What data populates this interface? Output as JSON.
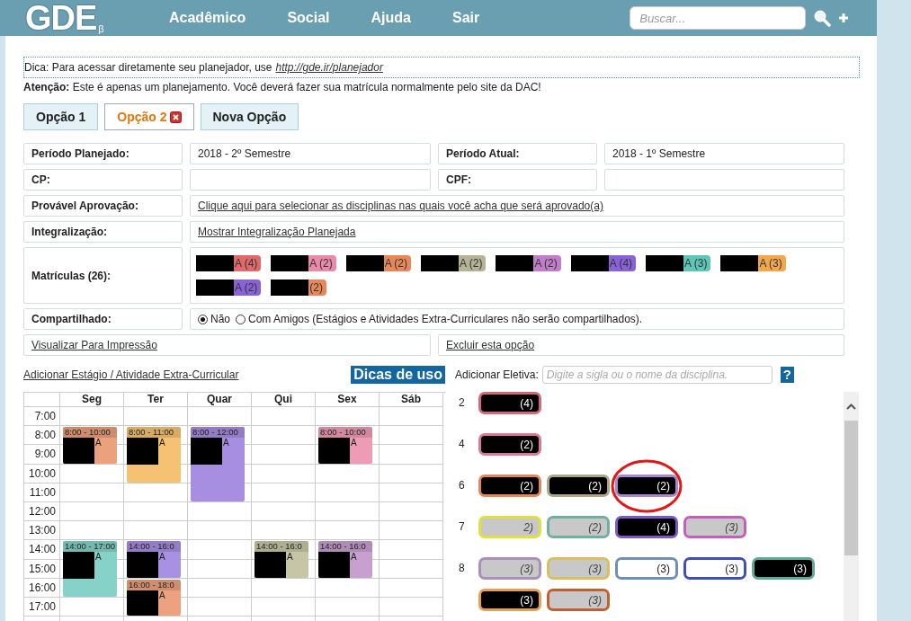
{
  "header": {
    "logo": "GDE",
    "logo_mark": "β",
    "nav": [
      "Acadêmico",
      "Social",
      "Ajuda",
      "Sair"
    ],
    "search": {
      "placeholder": "Buscar..."
    }
  },
  "tip": {
    "text": "Dica: Para acessar diretamente seu planejador, use",
    "link": "http://gde.ir/planejador"
  },
  "notice": "**Atenção:** Este é apenas um planejamento. Você deverá fazer sua matrícula normalmente pelo site da DAC!",
  "tabs": [
    {
      "label": "Opção 1",
      "selected": false,
      "closable": false
    },
    {
      "label": "Opção 2",
      "selected": true,
      "closable": true
    },
    {
      "label": "Nova Opção",
      "selected": false,
      "closable": false
    }
  ],
  "form": {
    "planned_period": {
      "label": "Período Planejado:",
      "value": "2018 - 2º Semestre"
    },
    "current_period": {
      "label": "Período Atual:",
      "value": "2018 - 1º Semestre"
    },
    "cp": {
      "label": "CP:"
    },
    "cpf": {
      "label": "CPF:"
    },
    "approval": {
      "label": "Provável Aprovação:",
      "link": "Clique aqui para selecionar as disciplinas nas quais você acha que será aprovado(a)"
    },
    "integration": {
      "label": "Integralização:",
      "link": "Mostrar Integralização Planejada"
    },
    "enrollments": {
      "label": "Matrículas (26):",
      "chips": [
        {
          "color": "#e06a6a",
          "text": "A (4)"
        },
        {
          "color": "#ea8aaa",
          "text": "A (2)"
        },
        {
          "color": "#e8885a",
          "text": "A (2)"
        },
        {
          "color": "#b4b494",
          "text": "A (2)"
        },
        {
          "color": "#c07ec8",
          "text": "A (2)"
        },
        {
          "color": "#8a62d8",
          "text": "A (4)"
        },
        {
          "color": "#5ec6b6",
          "text": "A (3)"
        },
        {
          "color": "#f2a84a",
          "text": "A (3)"
        },
        {
          "color": "#8a62d8",
          "text": "A (2)"
        },
        {
          "color": "#e8885a",
          "text": "(2)"
        }
      ]
    },
    "shared": {
      "label": "Compartilhado:",
      "options": [
        {
          "label": "Não",
          "selected": true
        },
        {
          "label": "Com Amigos (Estágios e Atividades Extra-Curriculares não serão compartilhados).",
          "selected": false
        }
      ]
    },
    "print_link": "Visualizar Para Impressão",
    "delete_link": "Excluir esta opção"
  },
  "schedule": {
    "add_link": "Adicionar Estágio / Atividade Extra-Curricular",
    "tips_button": "Dicas de uso",
    "hours": [
      "7:00",
      "8:00",
      "9:00",
      "10:00",
      "11:00",
      "12:00",
      "13:00",
      "14:00",
      "15:00",
      "16:00",
      "17:00"
    ],
    "days": [
      {
        "label": "Seg",
        "events": [
          {
            "start": "8:00",
            "dash": "-",
            "end": "10:00",
            "text": "A",
            "color": "#eba07e"
          },
          {
            "start": "14:00",
            "dash": "-",
            "end": "17:00",
            "text": "A",
            "color": "#86d2c8"
          }
        ]
      },
      {
        "label": "Ter",
        "events": [
          {
            "start": "8:00",
            "dash": "-",
            "end": "11:00",
            "text": "A",
            "color": "#f5c274"
          },
          {
            "start": "14:00",
            "dash": "-",
            "end": "16:0",
            "text": "A",
            "color": "#a890e2"
          },
          {
            "start": "16:00",
            "dash": "-",
            "end": "18:0",
            "text": "A",
            "color": "#eca27e"
          }
        ]
      },
      {
        "label": "Quar",
        "events": [
          {
            "start": "8:00",
            "dash": "-",
            "end": "12:00",
            "text": "A",
            "color": "#a88ee0"
          }
        ]
      },
      {
        "label": "Qui",
        "events": [
          {
            "start": "14:00",
            "dash": "-",
            "end": "16:0",
            "text": "A",
            "color": "#c6c6a6"
          }
        ]
      },
      {
        "label": "Sex",
        "events": [
          {
            "start": "8:00",
            "dash": "-",
            "end": "10:00",
            "text": "A",
            "color": "#ee9cb6"
          },
          {
            "start": "14:00",
            "dash": "-",
            "end": "16:0",
            "text": "A",
            "color": "#c8a0d0"
          }
        ]
      },
      {
        "label": "Sáb"
      }
    ]
  },
  "electives": {
    "label": "Adicionar Eletiva:",
    "placeholder": "Digite a sigla ou o nome da disciplina.",
    "help": "?",
    "rows": [
      {
        "semester": "2",
        "chips": [
          {
            "kind": "redacted",
            "color": "#d06a78",
            "text": "(4)",
            "circled": false
          }
        ]
      },
      {
        "semester": "4",
        "chips": [
          {
            "kind": "redacted",
            "color": "#d8789a",
            "text": "(2)",
            "circled": false
          }
        ]
      },
      {
        "semester": "6",
        "chips": [
          {
            "kind": "redacted",
            "color": "#e0885a",
            "text": "(2)",
            "circled": false
          },
          {
            "kind": "redacted",
            "color": "#a8a888",
            "text": "(2)",
            "circled": false
          },
          {
            "kind": "redacted",
            "color": "#a888c8",
            "text": "(2)",
            "circled": true
          }
        ]
      },
      {
        "semester": "7",
        "chips": [
          {
            "kind": "grey",
            "color": "#e0e040",
            "text": "2)",
            "circled": false
          },
          {
            "kind": "grey",
            "color": "#70b0a0",
            "text": "(2)",
            "circled": false
          },
          {
            "kind": "redacted",
            "color": "#7a5ac0",
            "text": "(4)",
            "circled": false
          },
          {
            "kind": "grey",
            "color": "#c060b8",
            "text": "(3)",
            "circled": false
          }
        ]
      },
      {
        "semester": "8",
        "chips": [
          {
            "kind": "grey",
            "color": "#a890b8",
            "text": "(3)",
            "circled": false
          },
          {
            "kind": "grey",
            "color": "#d8c060",
            "text": "(3)",
            "circled": false
          },
          {
            "kind": "white",
            "color": "#7090b0",
            "text": "(3)",
            "circled": false
          },
          {
            "kind": "white",
            "color": "#4050b0",
            "text": "(3)",
            "circled": false
          },
          {
            "kind": "redacted",
            "color": "#60a898",
            "text": "(3)",
            "circled": false
          },
          {
            "kind": "redacted",
            "color": "#e8a050",
            "text": "(3)",
            "circled": false
          },
          {
            "kind": "grey",
            "color": "#c06030",
            "text": "(3)",
            "circled": false
          }
        ]
      }
    ]
  }
}
